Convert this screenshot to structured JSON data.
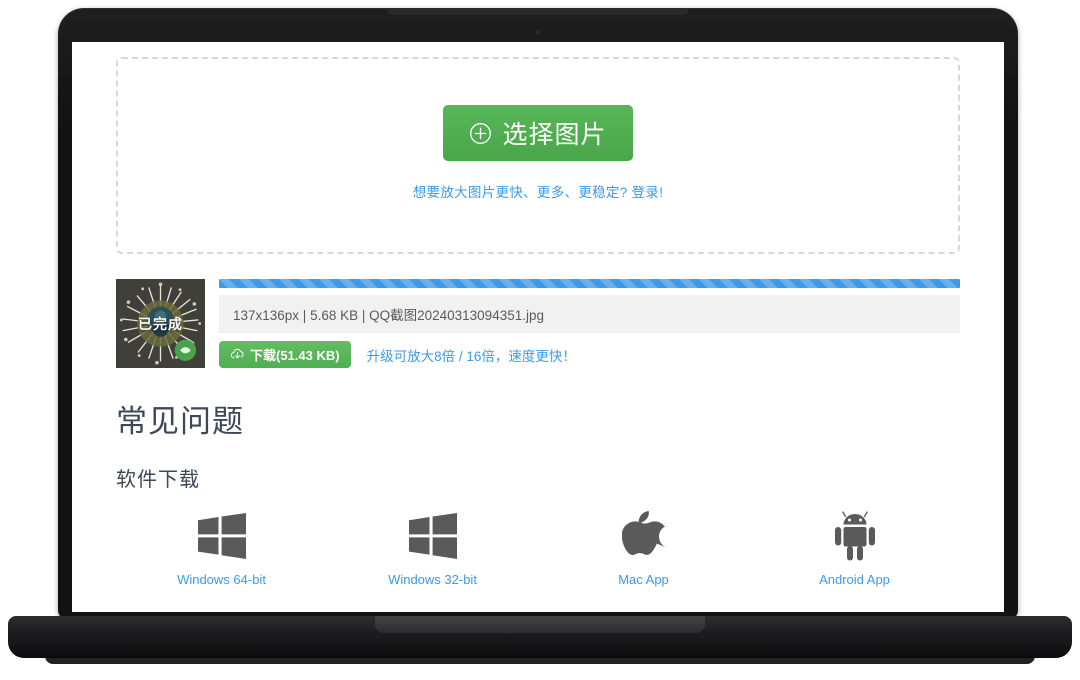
{
  "device": {
    "type": "laptop-mockup",
    "frame_color": "#121212",
    "screen_background": "#ffffff"
  },
  "uploader": {
    "select_button_label": "选择图片",
    "select_button_icon": "plus-circle-icon",
    "select_button_color": "#4cae4c",
    "login_hint": "想要放大图片更快、更多、更稳定? 登录!",
    "login_hint_color": "#3c9ae8"
  },
  "file_result": {
    "thumbnail_label": "已完成",
    "progress_percent": 100,
    "progress_color": "#3c9ae8",
    "meta": "137x136px | 5.68 KB | QQ截图20240313094351.jpg",
    "dimensions": "137x136px",
    "original_size": "5.68 KB",
    "file_name": "QQ截图20240313094351.jpg",
    "download_label": "下载(51.43 KB)",
    "download_size": "51.43 KB",
    "download_icon": "cloud-download-icon",
    "download_color": "#5cb85c",
    "upgrade_link": "升级可放大8倍 / 16倍，速度更快！",
    "upgrade_link_color": "#3c9ae8"
  },
  "faq": {
    "title": "常见问题",
    "subtitle": "软件下载",
    "title_color": "#3c4858"
  },
  "platforms": [
    {
      "label": "Windows 64-bit",
      "icon": "windows-icon"
    },
    {
      "label": "Windows 32-bit",
      "icon": "windows-icon"
    },
    {
      "label": "Mac App",
      "icon": "apple-icon"
    },
    {
      "label": "Android App",
      "icon": "android-icon"
    }
  ]
}
